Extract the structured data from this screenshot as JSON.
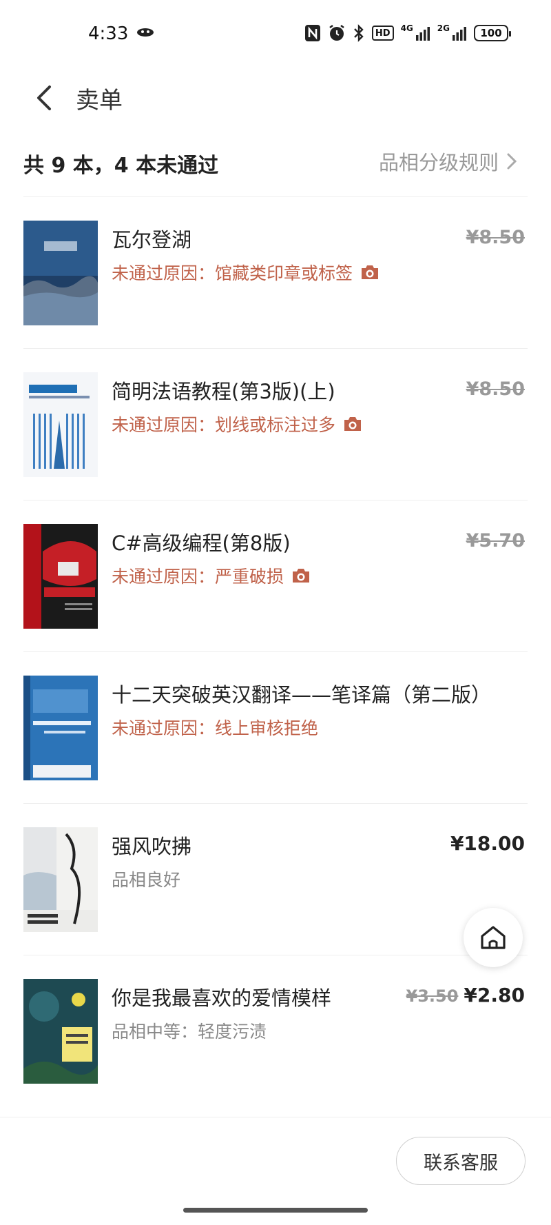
{
  "status_bar": {
    "time": "4:33",
    "icons": [
      "nfc-icon",
      "alarm-icon",
      "bluetooth-icon",
      "hd-icon",
      "signal-4g-icon",
      "signal-2g-icon"
    ],
    "hd": "HD",
    "net1": "4G",
    "net2": "2G",
    "battery": "100"
  },
  "header": {
    "title": "卖单"
  },
  "summary": {
    "text": "共 9 本，4 本未通过",
    "rules_link": "品相分级规则"
  },
  "colors": {
    "reject_text": "#c0624a",
    "muted": "#999999"
  },
  "items": [
    {
      "title": "瓦尔登湖",
      "reason": "未通过原因：馆藏类印章或标签",
      "has_photo": true,
      "price_struck": "¥8.50"
    },
    {
      "title": "简明法语教程(第3版)(上)",
      "reason": "未通过原因：划线或标注过多",
      "has_photo": true,
      "price_struck": "¥8.50"
    },
    {
      "title": "C#高级编程(第8版)",
      "reason": "未通过原因：严重破损",
      "has_photo": true,
      "price_struck": "¥5.70"
    },
    {
      "title": "十二天突破英汉翻译——笔译篇（第二版）",
      "reason": "未通过原因：线上审核拒绝",
      "has_photo": false
    },
    {
      "title": "强风吹拂",
      "grade": "品相良好",
      "price": "¥18.00"
    },
    {
      "title": "你是我最喜欢的爱情模样",
      "grade": "品相中等：轻度污渍",
      "price_old": "¥3.50",
      "price_new": "¥2.80"
    }
  ],
  "footer": {
    "contact_label": "联系客服"
  }
}
